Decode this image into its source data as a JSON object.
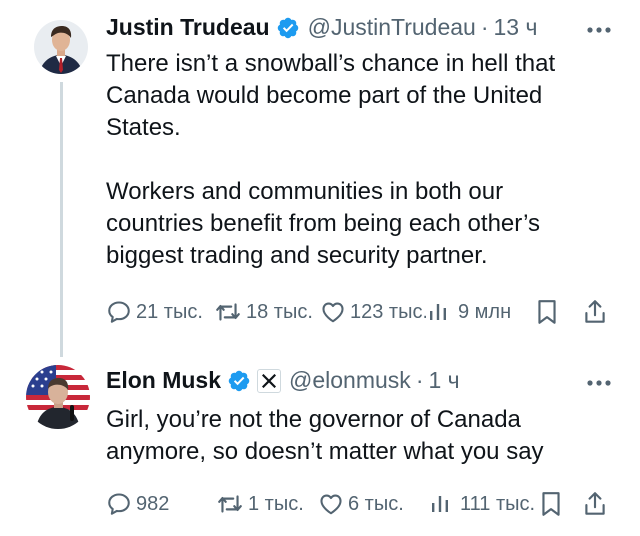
{
  "thread": {
    "tweets": [
      {
        "author": {
          "name": "Justin Trudeau",
          "handle": "@JustinTrudeau",
          "time": "13 ч",
          "verified": true
        },
        "text": [
          "There isn’t a snowball’s chance in hell that Canada would become part of the United States.",
          "Workers and communities in both our countries benefit from being each other’s biggest trading and security partner."
        ],
        "stats": {
          "replies": "21 тыс.",
          "reposts": "18 тыс.",
          "likes": "123 тыс.",
          "views": "9 млн"
        }
      },
      {
        "author": {
          "name": "Elon Musk",
          "handle": "@elonmusk",
          "time": "1 ч",
          "verified": true,
          "affiliation": "X"
        },
        "text": [
          "Girl, you’re not the governor of Canada anymore, so doesn’t matter what you say"
        ],
        "stats": {
          "replies": "982",
          "reposts": "1 тыс.",
          "likes": "6 тыс.",
          "views": "111 тыс."
        }
      }
    ]
  },
  "separator": "·",
  "colors": {
    "text": "#0f1419",
    "secondary": "#536471",
    "verified": "#1d9bf0",
    "thread_line": "#cfd9de"
  },
  "icons": {
    "reply": "speech-bubble-icon",
    "repost": "repost-arrows-icon",
    "like": "heart-outline-icon",
    "views": "bar-chart-icon",
    "bookmark": "bookmark-icon",
    "share": "upload-share-icon",
    "more": "more-dots-icon",
    "verified": "verified-badge-icon"
  }
}
